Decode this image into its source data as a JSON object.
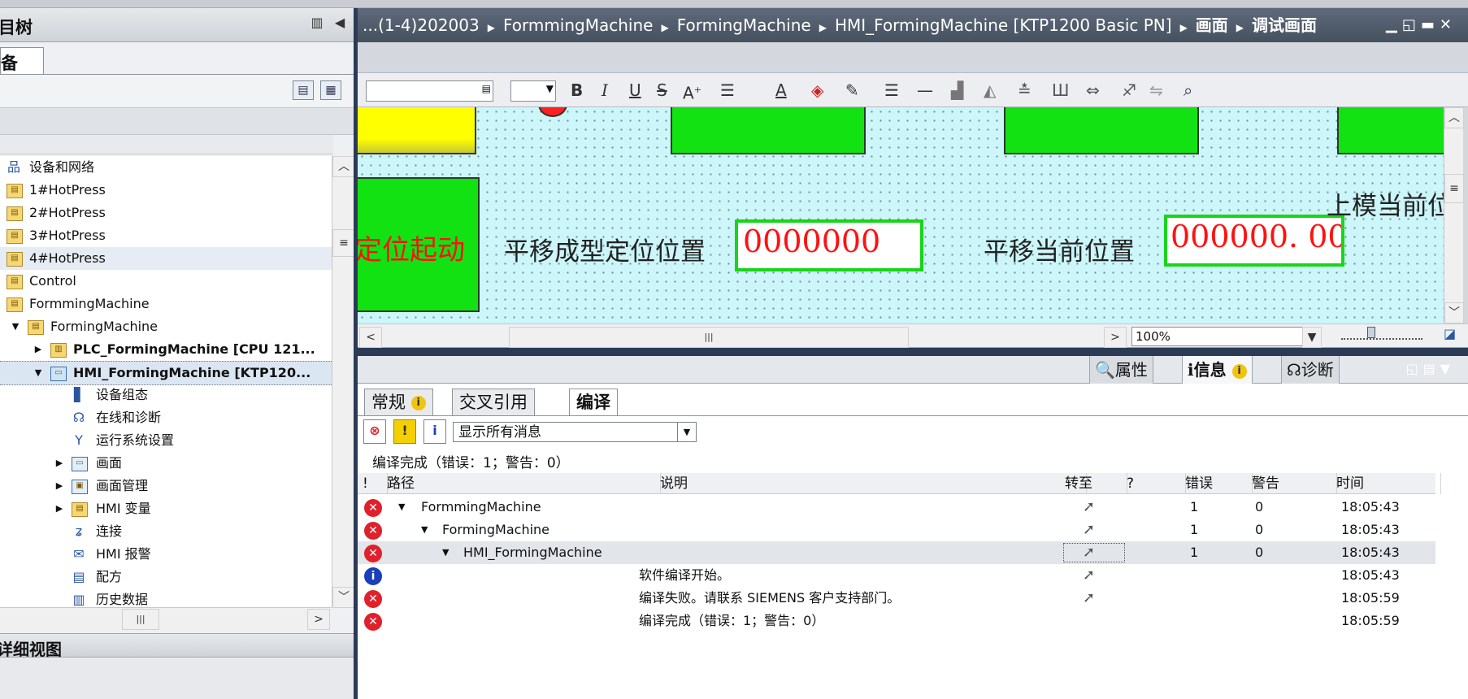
{
  "left_pane": {
    "title": "目树",
    "tab": "备",
    "tree": [
      {
        "label": "设备和网络",
        "icon": "network-icon",
        "level": 0
      },
      {
        "label": "1#HotPress",
        "icon": "folder-icon",
        "level": 0
      },
      {
        "label": "2#HotPress",
        "icon": "folder-icon",
        "level": 0
      },
      {
        "label": "3#HotPress",
        "icon": "folder-icon",
        "level": 0
      },
      {
        "label": "4#HotPress",
        "icon": "folder-icon",
        "level": 0
      },
      {
        "label": "Control",
        "icon": "folder-icon",
        "level": 0
      },
      {
        "label": "FormmingMachine",
        "icon": "folder-icon",
        "level": 0
      },
      {
        "label": "FormingMachine",
        "icon": "folder-icon",
        "level": 0
      },
      {
        "label": "PLC_FormingMachine [CPU 121...",
        "icon": "plc-icon",
        "level": 1
      },
      {
        "label": "HMI_FormingMachine [KTP120...",
        "icon": "hmi-icon",
        "level": 1
      },
      {
        "label": "设备组态",
        "icon": "device-config-icon",
        "level": 2
      },
      {
        "label": "在线和诊断",
        "icon": "diagnostics-icon",
        "level": 2
      },
      {
        "label": "运行系统设置",
        "icon": "runtime-settings-icon",
        "level": 2
      },
      {
        "label": "画面",
        "icon": "screens-folder-icon",
        "level": 2
      },
      {
        "label": "画面管理",
        "icon": "screen-management-icon",
        "level": 2
      },
      {
        "label": "HMI 变量",
        "icon": "hmi-tags-icon",
        "level": 2
      },
      {
        "label": "连接",
        "icon": "connections-icon",
        "level": 2
      },
      {
        "label": "HMI 报警",
        "icon": "hmi-alarms-icon",
        "level": 2
      },
      {
        "label": "配方",
        "icon": "recipes-icon",
        "level": 2
      },
      {
        "label": "历史数据",
        "icon": "historical-data-icon",
        "level": 2
      }
    ],
    "detail_view_title": "详细视图"
  },
  "breadcrumb": [
    "...(1-4)202003",
    "FormmingMachine",
    "FormingMachine",
    "HMI_FormingMachine [KTP1200 Basic PN]",
    "画面",
    "调试画面"
  ],
  "format_toolbar": {
    "bold": "B",
    "italic": "I",
    "underline": "U",
    "strike": "S"
  },
  "canvas": {
    "start_text": "定位起动",
    "label1": "平移成型定位位置",
    "field1": "0000000",
    "label2": "平移当前位置",
    "field2": "000000. 00",
    "label3": "上模当前位"
  },
  "zoom": "100%",
  "inspector": {
    "tabs": [
      {
        "label": "属性",
        "icon": "properties-icon"
      },
      {
        "label": "信息",
        "icon": "info-icon"
      },
      {
        "label": "诊断",
        "icon": "diagnostics-icon"
      }
    ],
    "sub_tabs": [
      "常规",
      "交叉引用",
      "编译"
    ],
    "filter": "显示所有消息",
    "summary": "编译完成（错误：1；警告：0）",
    "columns": {
      "flag": "!",
      "path": "路径",
      "desc": "说明",
      "goto": "转至",
      "q": "?",
      "errors": "错误",
      "warnings": "警告",
      "time": "时间"
    },
    "rows": [
      {
        "status": "error",
        "path": "FormmingMachine",
        "indent": 0,
        "desc": "",
        "errors": "1",
        "warnings": "0",
        "time": "18:05:43"
      },
      {
        "status": "error",
        "path": "FormingMachine",
        "indent": 1,
        "desc": "",
        "errors": "1",
        "warnings": "0",
        "time": "18:05:43"
      },
      {
        "status": "error",
        "path": "HMI_FormingMachine",
        "indent": 2,
        "desc": "",
        "errors": "1",
        "warnings": "0",
        "time": "18:05:43"
      },
      {
        "status": "info",
        "path": "",
        "indent": 0,
        "desc": "软件编译开始。",
        "errors": "",
        "warnings": "",
        "time": "18:05:43"
      },
      {
        "status": "error",
        "path": "",
        "indent": 0,
        "desc": "编译失败。请联系 SIEMENS 客户支持部门。",
        "errors": "",
        "warnings": "",
        "time": "18:05:59"
      },
      {
        "status": "error",
        "path": "",
        "indent": 0,
        "desc": "编译完成（错误：1；警告：0）",
        "errors": "",
        "warnings": "",
        "time": "18:05:59"
      }
    ]
  },
  "colors": {
    "error": "#e0202a",
    "info": "#1a3fb8",
    "hmi_green": "#12e212",
    "hmi_red_text": "#ff1111",
    "canvas_bg": "#ccf6f9"
  }
}
